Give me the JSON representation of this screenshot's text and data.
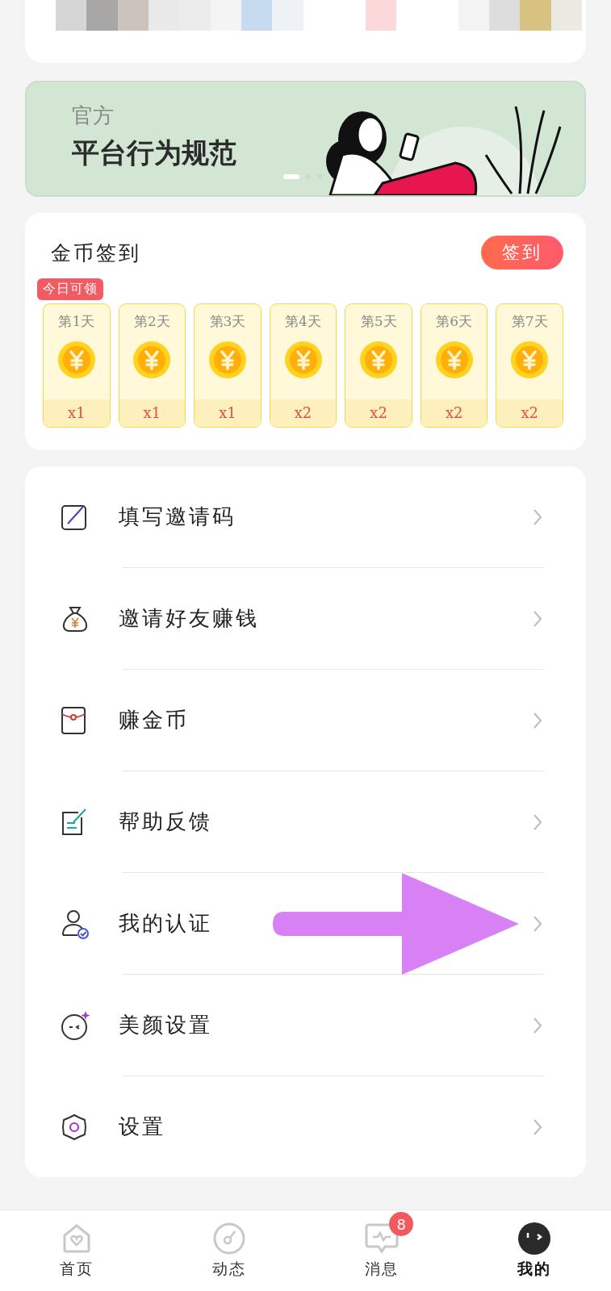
{
  "banner": {
    "kicker": "官方",
    "title": "平台行为规范",
    "dots": [
      {
        "selected": true
      },
      {
        "selected": false
      },
      {
        "selected": false
      }
    ]
  },
  "checkin": {
    "title": "金币签到",
    "button": "签到",
    "days": [
      {
        "label": "第1天",
        "reward": "x1",
        "badge": "今日可领"
      },
      {
        "label": "第2天",
        "reward": "x1"
      },
      {
        "label": "第3天",
        "reward": "x1"
      },
      {
        "label": "第4天",
        "reward": "x2"
      },
      {
        "label": "第5天",
        "reward": "x2"
      },
      {
        "label": "第6天",
        "reward": "x2"
      },
      {
        "label": "第7天",
        "reward": "x2"
      }
    ]
  },
  "menu": [
    {
      "kind": "invite-code",
      "label": "填写邀请码"
    },
    {
      "kind": "money-bag",
      "label": "邀请好友赚钱"
    },
    {
      "kind": "envelope",
      "label": "赚金币"
    },
    {
      "kind": "feedback",
      "label": "帮助反馈"
    },
    {
      "kind": "verify",
      "label": "我的认证",
      "pointer": true
    },
    {
      "kind": "beauty",
      "label": "美颜设置"
    },
    {
      "kind": "settings",
      "label": "设置"
    }
  ],
  "tabs": [
    {
      "kind": "home",
      "label": "首页",
      "selected": false
    },
    {
      "kind": "moments",
      "label": "动态",
      "selected": false
    },
    {
      "kind": "messages",
      "label": "消息",
      "selected": false,
      "badge": "8"
    },
    {
      "kind": "me",
      "label": "我的",
      "selected": true
    }
  ]
}
